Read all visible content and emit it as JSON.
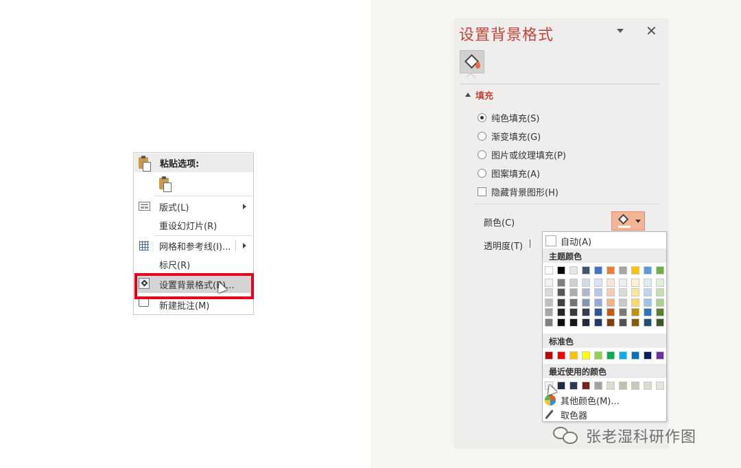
{
  "context_menu": {
    "paste_header": "粘贴选项:",
    "items": [
      {
        "label": "版式(L)"
      },
      {
        "label": "重设幻灯片(R)"
      },
      {
        "label": "网格和参考线(I)..."
      },
      {
        "label": "标尺(R)"
      },
      {
        "label": "设置背景格式(B)..."
      },
      {
        "label": "新建批注(M)"
      }
    ],
    "highlight_color": "#e3001b"
  },
  "pane": {
    "title": "设置背景格式",
    "close_glyph": "✕",
    "section": "填充",
    "options": [
      {
        "label": "纯色填充(S)",
        "selected": true
      },
      {
        "label": "渐变填充(G)",
        "selected": false
      },
      {
        "label": "图片或纹理填充(P)",
        "selected": false
      },
      {
        "label": "图案填充(A)",
        "selected": false
      }
    ],
    "hide_graphics": {
      "label": "隐藏背景图形(H)",
      "checked": false
    },
    "color_label": "颜色(C)",
    "transparency_label": "透明度(T)",
    "accent": "#c0453b"
  },
  "color_dropdown": {
    "auto": "自动(A)",
    "theme_header": "主题颜色",
    "standard_header": "标准色",
    "recent_header": "最近使用的颜色",
    "more_colors": "其他颜色(M)...",
    "eyedropper": "取色器",
    "theme_columns": [
      [
        "#ffffff",
        "#f2f2f2",
        "#d9d9d9",
        "#bfbfbf",
        "#a6a6a6",
        "#808080"
      ],
      [
        "#000000",
        "#7f7f7f",
        "#595959",
        "#404040",
        "#262626",
        "#0d0d0d"
      ],
      [
        "#e7e6e6",
        "#d0cece",
        "#afabab",
        "#767171",
        "#3b3838",
        "#171616"
      ],
      [
        "#44546a",
        "#d6dce5",
        "#adb9ca",
        "#8497b0",
        "#333f50",
        "#222a35"
      ],
      [
        "#4472c4",
        "#dae3f3",
        "#b4c7e7",
        "#8faadc",
        "#2f5597",
        "#203864"
      ],
      [
        "#ed7d31",
        "#fbe5d6",
        "#f8cbad",
        "#f4b183",
        "#c55a11",
        "#843c0c"
      ],
      [
        "#a5a5a5",
        "#ededed",
        "#dbdbdb",
        "#c9c9c9",
        "#7b7b7b",
        "#525252"
      ],
      [
        "#ffc000",
        "#fff2cc",
        "#ffe699",
        "#ffd966",
        "#bf9000",
        "#7f6000"
      ],
      [
        "#5b9bd5",
        "#deebf7",
        "#bdd7ee",
        "#9dc3e6",
        "#2e75b6",
        "#1f4e79"
      ],
      [
        "#70ad47",
        "#e2f0d9",
        "#c5e0b4",
        "#a9d18e",
        "#548235",
        "#385723"
      ]
    ],
    "standard_colors": [
      "#c00000",
      "#ff0000",
      "#ffc000",
      "#ffff00",
      "#92d050",
      "#00b050",
      "#00b0f0",
      "#0070c0",
      "#002060",
      "#7030a0"
    ],
    "recent_colors": [
      "#f6f6f0",
      "#1f2c45",
      "#2b3a55",
      "#7a1f1f",
      "#9ea3a8",
      "#dcdcd0",
      "#c3c1aa",
      "#c9c8b6",
      "#dadad0",
      "#e5e5da"
    ]
  },
  "watermark": "张老湿科研作图"
}
